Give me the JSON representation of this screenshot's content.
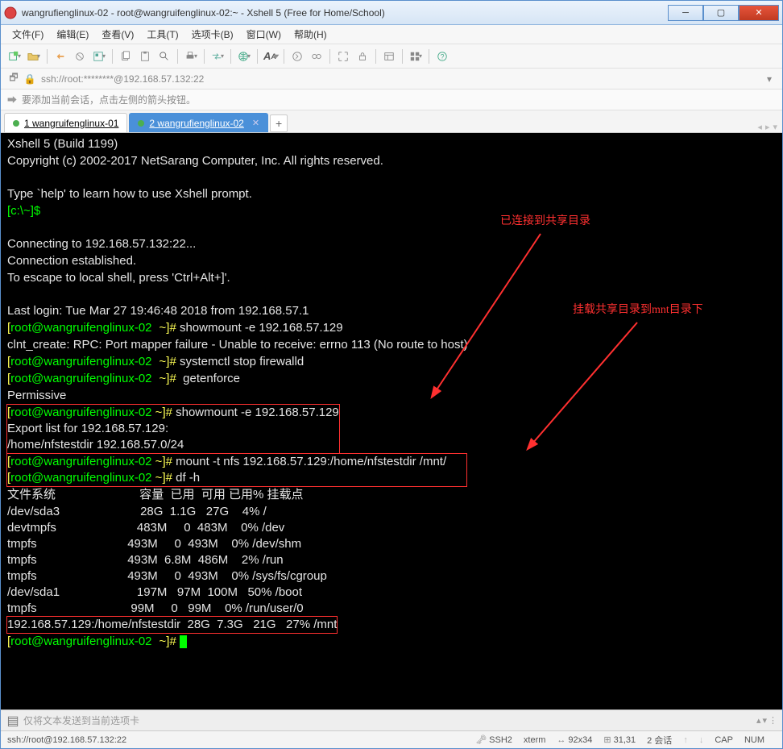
{
  "window": {
    "title": "wangrufienglinux-02 - root@wangruifenglinux-02:~ - Xshell 5 (Free for Home/School)"
  },
  "menus": [
    "文件(F)",
    "编辑(E)",
    "查看(V)",
    "工具(T)",
    "选项卡(B)",
    "窗口(W)",
    "帮助(H)"
  ],
  "address": "ssh://root:********@192.168.57.132:22",
  "infobar": "要添加当前会话，点击左侧的箭头按钮。",
  "tabs": [
    {
      "label": "1 wangruifenglinux-01",
      "active": false
    },
    {
      "label": "2 wangrufienglinux-02",
      "active": true
    }
  ],
  "terminal": {
    "l1": "Xshell 5 (Build 1199)",
    "l2": "Copyright (c) 2002-2017 NetSarang Computer, Inc. All rights reserved.",
    "l3": "Type `help' to learn how to use Xshell prompt.",
    "prompt_local": "[c:\\~]$",
    "l4": "Connecting to 192.168.57.132:22...",
    "l5": "Connection established.",
    "l6": "To escape to local shell, press 'Ctrl+Alt+]'.",
    "l7": "Last login: Tue Mar 27 19:46:48 2018 from 192.168.57.1",
    "prompt_user": "root@wangruifenglinux-02",
    "prompt_path": "~",
    "cmd1": "showmount -e 192.168.57.129",
    "err1": "clnt_create: RPC: Port mapper failure - Unable to receive: errno 113 (No route to host)",
    "cmd2": "systemctl stop firewalld",
    "cmd3": " getenforce",
    "out3": "Permissive",
    "cmd4": "showmount -e 192.168.57.129",
    "out4a": "Export list for 192.168.57.129:",
    "out4b": "/home/nfstestdir 192.168.57.0/24",
    "cmd5": "mount -t nfs 192.168.57.129:/home/nfstestdir /mnt/",
    "cmd6": "df -h",
    "df_header": "文件系统                         容量  已用  可用 已用% 挂载点",
    "df_rows": [
      "/dev/sda3                        28G  1.1G   27G    4% /",
      "devtmpfs                        483M     0  483M    0% /dev",
      "tmpfs                           493M     0  493M    0% /dev/shm",
      "tmpfs                           493M  6.8M  486M    2% /run",
      "tmpfs                           493M     0  493M    0% /sys/fs/cgroup",
      "/dev/sda1                       197M   97M  100M   50% /boot",
      "tmpfs                            99M     0   99M    0% /run/user/0",
      "192.168.57.129:/home/nfstestdir  28G  7.3G   21G   27% /mnt"
    ]
  },
  "annotations": {
    "a1": "已连接到共享目录",
    "a2": "挂载共享目录到mnt目录下"
  },
  "sendbar": "仅将文本发送到当前选项卡",
  "status": {
    "conn": "ssh://root@192.168.57.132:22",
    "ssh": "SSH2",
    "term": "xterm",
    "size": "92x34",
    "pos": "31,31",
    "sess": "2 会话",
    "cap": "CAP",
    "num": "NUM"
  }
}
